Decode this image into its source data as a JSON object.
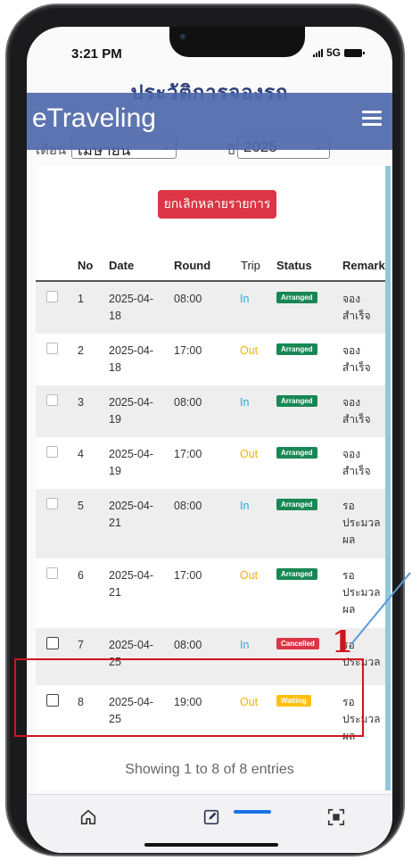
{
  "status_bar": {
    "time": "3:21 PM",
    "network": "5G"
  },
  "background_title": "ประวัติการจองรถ",
  "app": {
    "brand": "eTraveling"
  },
  "filters": {
    "month_label": "เดือน",
    "month_value": "เมษายน",
    "year_label": "ปี",
    "year_value": "2025"
  },
  "actions": {
    "cancel_multiple": "ยกเลิกหลายรายการ"
  },
  "table": {
    "headers": {
      "no": "No",
      "date": "Date",
      "round": "Round",
      "trip": "Trip",
      "status": "Status",
      "remark": "Remark"
    },
    "rows": [
      {
        "no": "1",
        "date_a": "2025-04-",
        "date_b": "18",
        "round": "08:00",
        "trip": "In",
        "status": "Arranged",
        "remark_a": "จอง",
        "remark_b": "สำเร็จ",
        "remark_c": ""
      },
      {
        "no": "2",
        "date_a": "2025-04-",
        "date_b": "18",
        "round": "17:00",
        "trip": "Out",
        "status": "Arranged",
        "remark_a": "จอง",
        "remark_b": "สำเร็จ",
        "remark_c": ""
      },
      {
        "no": "3",
        "date_a": "2025-04-",
        "date_b": "19",
        "round": "08:00",
        "trip": "In",
        "status": "Arranged",
        "remark_a": "จอง",
        "remark_b": "สำเร็จ",
        "remark_c": ""
      },
      {
        "no": "4",
        "date_a": "2025-04-",
        "date_b": "19",
        "round": "17:00",
        "trip": "Out",
        "status": "Arranged",
        "remark_a": "จอง",
        "remark_b": "สำเร็จ",
        "remark_c": ""
      },
      {
        "no": "5",
        "date_a": "2025-04-",
        "date_b": "21",
        "round": "08:00",
        "trip": "In",
        "status": "Arranged",
        "remark_a": "รอ",
        "remark_b": "ประมวล",
        "remark_c": "ผล"
      },
      {
        "no": "6",
        "date_a": "2025-04-",
        "date_b": "21",
        "round": "17:00",
        "trip": "Out",
        "status": "Arranged",
        "remark_a": "รอ",
        "remark_b": "ประมวล",
        "remark_c": "ผล"
      },
      {
        "no": "7",
        "date_a": "2025-04-",
        "date_b": "25",
        "round": "08:00",
        "trip": "In",
        "status": "Cancelled",
        "remark_a": "รอ",
        "remark_b": "ประมวล",
        "remark_c": ""
      },
      {
        "no": "8",
        "date_a": "2025-04-",
        "date_b": "25",
        "round": "19:00",
        "trip": "Out",
        "status": "Waiting",
        "remark_a": "รอ",
        "remark_b": "ประมวล",
        "remark_c": "ผล"
      }
    ]
  },
  "annotation": {
    "number": "1"
  },
  "footer": {
    "entries_info": "Showing 1 to 8 of 8 entries"
  },
  "colors": {
    "arranged": "#198754",
    "cancelled": "#dc3545",
    "waiting": "#ffc107",
    "highlight": "#d0151d",
    "appbar": "#4e68aa"
  },
  "tabbar": {
    "icons": [
      "home-icon",
      "edit-icon",
      "qr-scan-icon"
    ]
  }
}
